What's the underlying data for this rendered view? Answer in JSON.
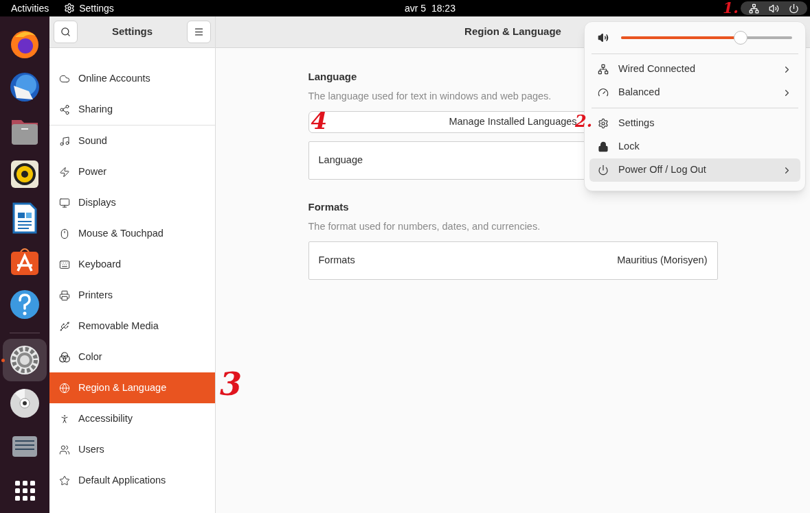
{
  "top_bar": {
    "activities": "Activities",
    "app_menu": "Settings",
    "date": "avr 5",
    "time": "18:23",
    "annotation": "1."
  },
  "dock": [
    {
      "kind": "browser",
      "running": false
    },
    {
      "kind": "mail",
      "running": false
    },
    {
      "kind": "files",
      "running": false
    },
    {
      "kind": "music",
      "running": false
    },
    {
      "kind": "writer",
      "running": false
    },
    {
      "kind": "store",
      "running": false
    },
    {
      "kind": "help",
      "running": false
    },
    {
      "kind": "settings",
      "running": true
    },
    {
      "kind": "disc",
      "running": false
    },
    {
      "kind": "drive",
      "running": false
    },
    {
      "kind": "grid",
      "running": false
    }
  ],
  "window": {
    "sidebar_title": "Settings",
    "title": "Region & Language"
  },
  "sidebar": {
    "groups": [
      {
        "items": [
          {
            "kind": "cloud",
            "label": "Online Accounts",
            "selected": false
          },
          {
            "kind": "share",
            "label": "Sharing",
            "selected": false
          }
        ]
      },
      {
        "items": [
          {
            "kind": "music",
            "label": "Sound",
            "selected": false
          },
          {
            "kind": "power",
            "label": "Power",
            "selected": false
          },
          {
            "kind": "monitor",
            "label": "Displays",
            "selected": false
          },
          {
            "kind": "mouse",
            "label": "Mouse & Touchpad",
            "selected": false
          },
          {
            "kind": "keyboard",
            "label": "Keyboard",
            "selected": false
          },
          {
            "kind": "printer",
            "label": "Printers",
            "selected": false
          },
          {
            "kind": "usb",
            "label": "Removable Media",
            "selected": false
          },
          {
            "kind": "color",
            "label": "Color",
            "selected": false
          },
          {
            "kind": "globe",
            "label": "Region & Language",
            "selected": true,
            "annotation": "3"
          },
          {
            "kind": "person",
            "label": "Accessibility",
            "selected": false
          },
          {
            "kind": "users",
            "label": "Users",
            "selected": false
          },
          {
            "kind": "star",
            "label": "Default Applications",
            "selected": false
          }
        ]
      }
    ]
  },
  "content": {
    "sections": [
      {
        "title": "Language",
        "description": "The language used for text in windows and web pages.",
        "button": {
          "label": "Manage Installed Languages",
          "annotation": "4"
        },
        "rows": [
          {
            "label": "Language"
          }
        ]
      },
      {
        "title": "Formats",
        "description": "The format used for numbers, dates, and currencies.",
        "rows": [
          {
            "label": "Formats",
            "value": "Mauritius (Morisyen)"
          }
        ]
      }
    ]
  },
  "popup": {
    "volume": {
      "level": 0.7
    },
    "groups": [
      {
        "items": [
          {
            "kind": "network",
            "label": "Wired Connected",
            "submenu": true,
            "selected": false
          },
          {
            "kind": "gauge",
            "label": "Balanced",
            "submenu": true,
            "selected": false
          }
        ]
      },
      {
        "items": [
          {
            "kind": "settings",
            "label": "Settings",
            "submenu": false,
            "selected": false,
            "annotation": "2."
          },
          {
            "kind": "lock",
            "label": "Lock",
            "submenu": false,
            "selected": false
          },
          {
            "kind": "power",
            "label": "Power Off / Log Out",
            "submenu": true,
            "selected": true
          }
        ]
      }
    ]
  }
}
